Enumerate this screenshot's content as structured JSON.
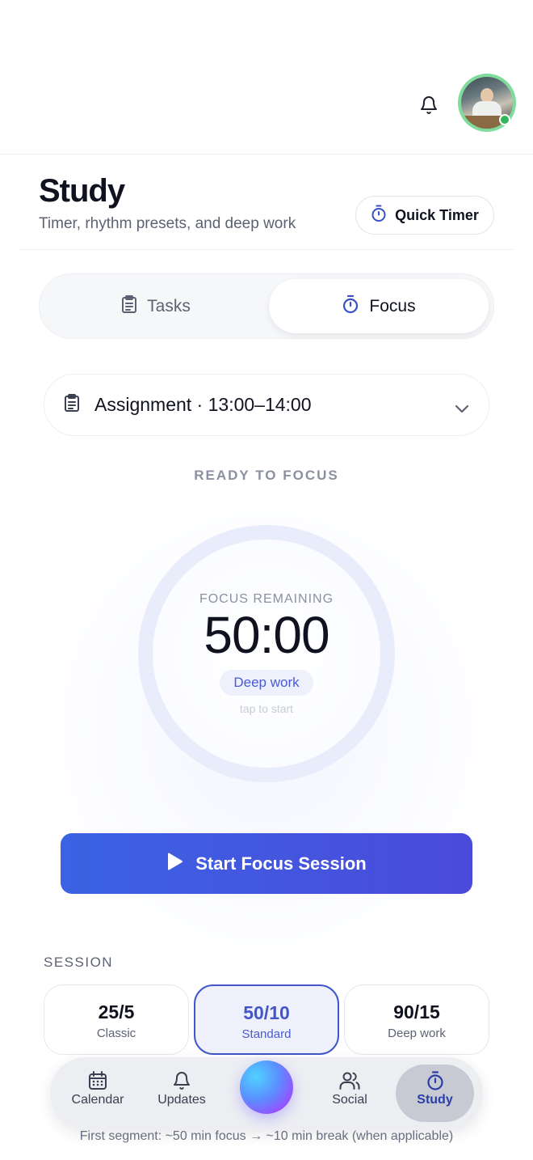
{
  "header": {
    "notifications_icon": "bell-icon",
    "avatar_alt": "profile-avatar",
    "online_color": "#31b75a"
  },
  "page": {
    "title": "Study",
    "subtitle": "Timer, rhythm presets, and deep work",
    "quick_timer_label": "Quick Timer"
  },
  "tabs": [
    {
      "label": "Tasks",
      "icon": "clipboard-icon",
      "active": false
    },
    {
      "label": "Focus",
      "icon": "stopwatch-icon",
      "active": true
    }
  ],
  "assignment": {
    "selected": "Assignment · 13:00–14:00",
    "icon": "clipboard-icon"
  },
  "timer": {
    "status": "READY TO FOCUS",
    "label": "FOCUS REMAINING",
    "time": "50:00",
    "mode": "Deep work",
    "hint": "tap to start"
  },
  "start_button": {
    "label": "Start Focus Session"
  },
  "session": {
    "label": "SESSION",
    "presets": [
      {
        "value": "25/5",
        "name": "Classic",
        "selected": false
      },
      {
        "value": "50/10",
        "name": "Standard",
        "selected": true
      },
      {
        "value": "90/15",
        "name": "Deep work",
        "selected": false
      }
    ],
    "footnote": "First segment: ~50 min focus → ~10 min break (when applicable)"
  },
  "nav": {
    "items": [
      {
        "label": "Calendar",
        "icon": "calendar-icon"
      },
      {
        "label": "Updates",
        "icon": "bell-icon"
      },
      {
        "label": "Social",
        "icon": "users-icon"
      },
      {
        "label": "Study",
        "icon": "stopwatch-icon",
        "active": true
      }
    ]
  },
  "colors": {
    "accent": "#4256c9",
    "button_gradient_start": "#3b63e3",
    "button_gradient_end": "#4b4ada"
  }
}
